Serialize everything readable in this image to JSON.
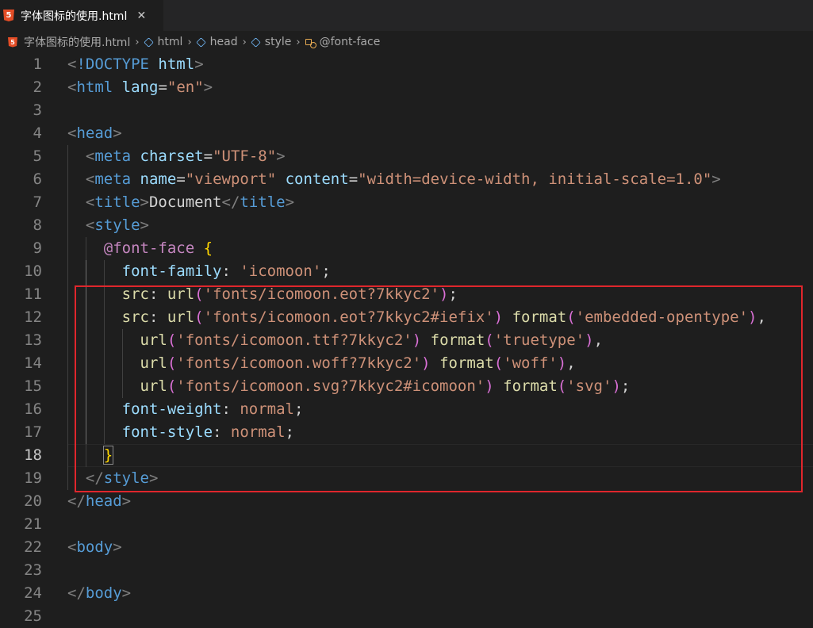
{
  "tab": {
    "icon": "html5-icon",
    "badge": "5",
    "title": "字体图标的使用.html",
    "close": "✕"
  },
  "breadcrumb": [
    {
      "label": "字体图标的使用.html",
      "icon": "html5-icon"
    },
    {
      "label": "html",
      "icon": "cube-icon"
    },
    {
      "label": "head",
      "icon": "cube-icon"
    },
    {
      "label": "style",
      "icon": "cube-icon"
    },
    {
      "label": "@font-face",
      "icon": "symbol-icon"
    }
  ],
  "separator": "›",
  "active_line": 18,
  "lines": [
    {
      "n": "1",
      "indent": 0,
      "tokens": [
        [
          "punc",
          "<"
        ],
        [
          "tag",
          "!DOCTYPE"
        ],
        [
          "text",
          " "
        ],
        [
          "attr",
          "html"
        ],
        [
          "punc",
          ">"
        ]
      ]
    },
    {
      "n": "2",
      "indent": 0,
      "tokens": [
        [
          "punc",
          "<"
        ],
        [
          "tag",
          "html"
        ],
        [
          "text",
          " "
        ],
        [
          "attr",
          "lang"
        ],
        [
          "text",
          "="
        ],
        [
          "str",
          "\"en\""
        ],
        [
          "punc",
          ">"
        ]
      ]
    },
    {
      "n": "3",
      "indent": 0,
      "tokens": []
    },
    {
      "n": "4",
      "indent": 0,
      "tokens": [
        [
          "punc",
          "<"
        ],
        [
          "tag",
          "head"
        ],
        [
          "punc",
          ">"
        ]
      ]
    },
    {
      "n": "5",
      "indent": 1,
      "tokens": [
        [
          "punc",
          "<"
        ],
        [
          "tag",
          "meta"
        ],
        [
          "text",
          " "
        ],
        [
          "attr",
          "charset"
        ],
        [
          "text",
          "="
        ],
        [
          "str",
          "\"UTF-8\""
        ],
        [
          "punc",
          ">"
        ]
      ]
    },
    {
      "n": "6",
      "indent": 1,
      "tokens": [
        [
          "punc",
          "<"
        ],
        [
          "tag",
          "meta"
        ],
        [
          "text",
          " "
        ],
        [
          "attr",
          "name"
        ],
        [
          "text",
          "="
        ],
        [
          "str",
          "\"viewport\""
        ],
        [
          "text",
          " "
        ],
        [
          "attr",
          "content"
        ],
        [
          "text",
          "="
        ],
        [
          "str",
          "\"width=device-width, initial-scale=1.0\""
        ],
        [
          "punc",
          ">"
        ]
      ]
    },
    {
      "n": "7",
      "indent": 1,
      "tokens": [
        [
          "punc",
          "<"
        ],
        [
          "tag",
          "title"
        ],
        [
          "punc",
          ">"
        ],
        [
          "text",
          "Document"
        ],
        [
          "punc",
          "</"
        ],
        [
          "tag",
          "title"
        ],
        [
          "punc",
          ">"
        ]
      ]
    },
    {
      "n": "8",
      "indent": 1,
      "tokens": [
        [
          "punc",
          "<"
        ],
        [
          "tag",
          "style"
        ],
        [
          "punc",
          ">"
        ]
      ]
    },
    {
      "n": "9",
      "indent": 2,
      "tokens": [
        [
          "at",
          "@font-face"
        ],
        [
          "text",
          " "
        ],
        [
          "brace",
          "{"
        ]
      ]
    },
    {
      "n": "10",
      "indent": 3,
      "tokens": [
        [
          "prop",
          "font-family"
        ],
        [
          "text",
          ": "
        ],
        [
          "str",
          "'icomoon'"
        ],
        [
          "text",
          ";"
        ]
      ]
    },
    {
      "n": "11",
      "indent": 3,
      "tokens": [
        [
          "fn",
          "src"
        ],
        [
          "text",
          ": "
        ],
        [
          "fn",
          "url"
        ],
        [
          "paren",
          "("
        ],
        [
          "str",
          "'fonts/icomoon.eot?7kkyc2'"
        ],
        [
          "paren",
          ")"
        ],
        [
          "text",
          ";"
        ]
      ]
    },
    {
      "n": "12",
      "indent": 3,
      "tokens": [
        [
          "fn",
          "src"
        ],
        [
          "text",
          ": "
        ],
        [
          "fn",
          "url"
        ],
        [
          "paren",
          "("
        ],
        [
          "str",
          "'fonts/icomoon.eot?7kkyc2#iefix'"
        ],
        [
          "paren",
          ")"
        ],
        [
          "text",
          " "
        ],
        [
          "fn",
          "format"
        ],
        [
          "paren",
          "("
        ],
        [
          "str",
          "'embedded-opentype'"
        ],
        [
          "paren",
          ")"
        ],
        [
          "text",
          ","
        ]
      ]
    },
    {
      "n": "13",
      "indent": 4,
      "tokens": [
        [
          "fn",
          "url"
        ],
        [
          "paren",
          "("
        ],
        [
          "str",
          "'fonts/icomoon.ttf?7kkyc2'"
        ],
        [
          "paren",
          ")"
        ],
        [
          "text",
          " "
        ],
        [
          "fn",
          "format"
        ],
        [
          "paren",
          "("
        ],
        [
          "str",
          "'truetype'"
        ],
        [
          "paren",
          ")"
        ],
        [
          "text",
          ","
        ]
      ]
    },
    {
      "n": "14",
      "indent": 4,
      "tokens": [
        [
          "fn",
          "url"
        ],
        [
          "paren",
          "("
        ],
        [
          "str",
          "'fonts/icomoon.woff?7kkyc2'"
        ],
        [
          "paren",
          ")"
        ],
        [
          "text",
          " "
        ],
        [
          "fn",
          "format"
        ],
        [
          "paren",
          "("
        ],
        [
          "str",
          "'woff'"
        ],
        [
          "paren",
          ")"
        ],
        [
          "text",
          ","
        ]
      ]
    },
    {
      "n": "15",
      "indent": 4,
      "tokens": [
        [
          "fn",
          "url"
        ],
        [
          "paren",
          "("
        ],
        [
          "str",
          "'fonts/icomoon.svg?7kkyc2#icomoon'"
        ],
        [
          "paren",
          ")"
        ],
        [
          "text",
          " "
        ],
        [
          "fn",
          "format"
        ],
        [
          "paren",
          "("
        ],
        [
          "str",
          "'svg'"
        ],
        [
          "paren",
          ")"
        ],
        [
          "text",
          ";"
        ]
      ]
    },
    {
      "n": "16",
      "indent": 3,
      "tokens": [
        [
          "prop",
          "font-weight"
        ],
        [
          "text",
          ": "
        ],
        [
          "kw",
          "normal"
        ],
        [
          "text",
          ";"
        ]
      ]
    },
    {
      "n": "17",
      "indent": 3,
      "tokens": [
        [
          "prop",
          "font-style"
        ],
        [
          "text",
          ": "
        ],
        [
          "kw",
          "normal"
        ],
        [
          "text",
          ";"
        ]
      ]
    },
    {
      "n": "18",
      "indent": 2,
      "tokens": [
        [
          "brace",
          "}"
        ]
      ]
    },
    {
      "n": "19",
      "indent": 1,
      "tokens": [
        [
          "punc",
          "</"
        ],
        [
          "tag",
          "style"
        ],
        [
          "punc",
          ">"
        ]
      ]
    },
    {
      "n": "20",
      "indent": 0,
      "tokens": [
        [
          "punc",
          "</"
        ],
        [
          "tag",
          "head"
        ],
        [
          "punc",
          ">"
        ]
      ]
    },
    {
      "n": "21",
      "indent": 0,
      "tokens": []
    },
    {
      "n": "22",
      "indent": 0,
      "tokens": [
        [
          "punc",
          "<"
        ],
        [
          "tag",
          "body"
        ],
        [
          "punc",
          ">"
        ]
      ]
    },
    {
      "n": "23",
      "indent": 0,
      "tokens": []
    },
    {
      "n": "24",
      "indent": 0,
      "tokens": [
        [
          "punc",
          "</"
        ],
        [
          "tag",
          "body"
        ],
        [
          "punc",
          ">"
        ]
      ]
    },
    {
      "n": "25",
      "indent": 0,
      "tokens": []
    }
  ]
}
